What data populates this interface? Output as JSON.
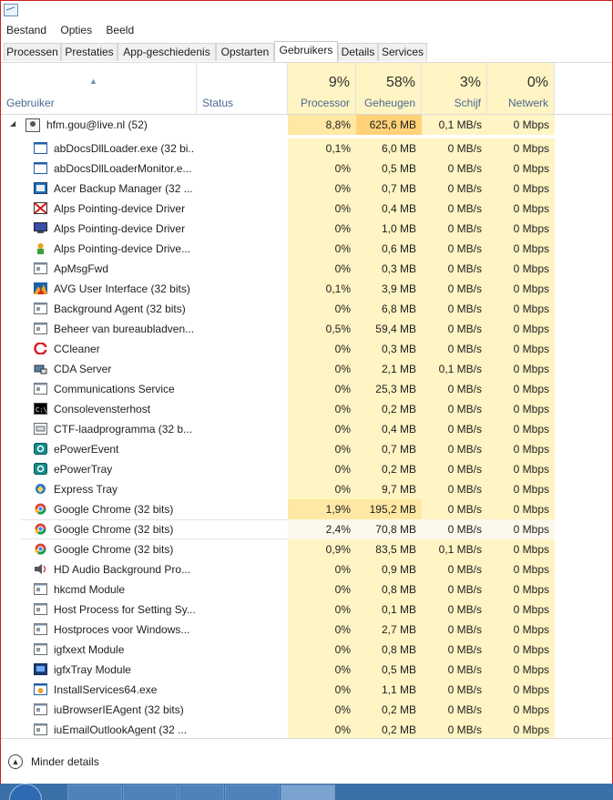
{
  "menu": [
    "Bestand",
    "Opties",
    "Beeld"
  ],
  "tabs": [
    {
      "label": "Processen",
      "active": false
    },
    {
      "label": "Prestaties",
      "active": false
    },
    {
      "label": "App-geschiedenis",
      "active": false
    },
    {
      "label": "Opstarten",
      "active": false
    },
    {
      "label": "Gebruikers",
      "active": true
    },
    {
      "label": "Details",
      "active": false
    },
    {
      "label": "Services",
      "active": false
    }
  ],
  "columns": {
    "user": "Gebruiker",
    "status": "Status",
    "cpu": {
      "pct": "9%",
      "label": "Processor"
    },
    "mem": {
      "pct": "58%",
      "label": "Geheugen"
    },
    "disk": {
      "pct": "3%",
      "label": "Schijf"
    },
    "net": {
      "pct": "0%",
      "label": "Netwerk"
    }
  },
  "group": {
    "name": "hfm.gou@live.nl (52)",
    "cpu": "8,8%",
    "mem": "625,6 MB",
    "disk": "0,1 MB/s",
    "net": "0 Mbps"
  },
  "processes": [
    {
      "name": "abDocsDllLoader.exe (32 bi...",
      "icon": "window-icon",
      "cpu": "0,1%",
      "mem": "6,0 MB",
      "disk": "0 MB/s",
      "net": "0 Mbps"
    },
    {
      "name": "abDocsDllLoaderMonitor.e...",
      "icon": "window-icon",
      "cpu": "0%",
      "mem": "0,5 MB",
      "disk": "0 MB/s",
      "net": "0 Mbps"
    },
    {
      "name": "Acer Backup Manager (32 ...",
      "icon": "backup-icon",
      "cpu": "0%",
      "mem": "0,7 MB",
      "disk": "0 MB/s",
      "net": "0 Mbps"
    },
    {
      "name": "Alps Pointing-device Driver",
      "icon": "alps-driver-icon",
      "cpu": "0%",
      "mem": "0,4 MB",
      "disk": "0 MB/s",
      "net": "0 Mbps"
    },
    {
      "name": "Alps Pointing-device Driver",
      "icon": "alps-monitor-icon",
      "cpu": "0%",
      "mem": "1,0 MB",
      "disk": "0 MB/s",
      "net": "0 Mbps"
    },
    {
      "name": "Alps Pointing-device Drive...",
      "icon": "alps-pointer-icon",
      "cpu": "0%",
      "mem": "0,6 MB",
      "disk": "0 MB/s",
      "net": "0 Mbps"
    },
    {
      "name": "ApMsgFwd",
      "icon": "service-icon",
      "cpu": "0%",
      "mem": "0,3 MB",
      "disk": "0 MB/s",
      "net": "0 Mbps"
    },
    {
      "name": "AVG User Interface (32 bits)",
      "icon": "avg-icon",
      "cpu": "0,1%",
      "mem": "3,9 MB",
      "disk": "0 MB/s",
      "net": "0 Mbps"
    },
    {
      "name": "Background Agent (32 bits)",
      "icon": "service-icon",
      "cpu": "0%",
      "mem": "6,8 MB",
      "disk": "0 MB/s",
      "net": "0 Mbps"
    },
    {
      "name": "Beheer van bureaubladven...",
      "icon": "service-icon",
      "cpu": "0,5%",
      "mem": "59,4 MB",
      "disk": "0 MB/s",
      "net": "0 Mbps"
    },
    {
      "name": "CCleaner",
      "icon": "ccleaner-icon",
      "cpu": "0%",
      "mem": "0,3 MB",
      "disk": "0 MB/s",
      "net": "0 Mbps"
    },
    {
      "name": "CDA Server",
      "icon": "cda-icon",
      "cpu": "0%",
      "mem": "2,1 MB",
      "disk": "0,1 MB/s",
      "net": "0 Mbps"
    },
    {
      "name": "Communications Service",
      "icon": "service-icon",
      "cpu": "0%",
      "mem": "25,3 MB",
      "disk": "0 MB/s",
      "net": "0 Mbps"
    },
    {
      "name": "Consolevensterhost",
      "icon": "console-icon",
      "cpu": "0%",
      "mem": "0,2 MB",
      "disk": "0 MB/s",
      "net": "0 Mbps"
    },
    {
      "name": "CTF-laadprogramma (32 b...",
      "icon": "ctf-icon",
      "cpu": "0%",
      "mem": "0,4 MB",
      "disk": "0 MB/s",
      "net": "0 Mbps"
    },
    {
      "name": "ePowerEvent",
      "icon": "epower-icon",
      "cpu": "0%",
      "mem": "0,7 MB",
      "disk": "0 MB/s",
      "net": "0 Mbps"
    },
    {
      "name": "ePowerTray",
      "icon": "epower-icon",
      "cpu": "0%",
      "mem": "0,2 MB",
      "disk": "0 MB/s",
      "net": "0 Mbps"
    },
    {
      "name": "Express Tray",
      "icon": "express-icon",
      "cpu": "0%",
      "mem": "9,7 MB",
      "disk": "0 MB/s",
      "net": "0 Mbps"
    },
    {
      "name": "Google Chrome (32 bits)",
      "icon": "chrome-icon",
      "cpu": "1,9%",
      "mem": "195,2 MB",
      "disk": "0 MB/s",
      "net": "0 Mbps"
    },
    {
      "name": "Google Chrome (32 bits)",
      "icon": "chrome-icon",
      "cpu": "2,4%",
      "mem": "70,8 MB",
      "disk": "0 MB/s",
      "net": "0 Mbps",
      "selected": true
    },
    {
      "name": "Google Chrome (32 bits)",
      "icon": "chrome-icon",
      "cpu": "0,9%",
      "mem": "83,5 MB",
      "disk": "0,1 MB/s",
      "net": "0 Mbps"
    },
    {
      "name": "HD Audio Background Pro...",
      "icon": "speaker-icon",
      "cpu": "0%",
      "mem": "0,9 MB",
      "disk": "0 MB/s",
      "net": "0 Mbps"
    },
    {
      "name": "hkcmd Module",
      "icon": "service-icon",
      "cpu": "0%",
      "mem": "0,8 MB",
      "disk": "0 MB/s",
      "net": "0 Mbps"
    },
    {
      "name": "Host Process for Setting Sy...",
      "icon": "service-icon",
      "cpu": "0%",
      "mem": "0,1 MB",
      "disk": "0 MB/s",
      "net": "0 Mbps"
    },
    {
      "name": "Hostproces voor Windows...",
      "icon": "service-icon",
      "cpu": "0%",
      "mem": "2,7 MB",
      "disk": "0 MB/s",
      "net": "0 Mbps"
    },
    {
      "name": "igfxext Module",
      "icon": "service-icon",
      "cpu": "0%",
      "mem": "0,8 MB",
      "disk": "0 MB/s",
      "net": "0 Mbps"
    },
    {
      "name": "igfxTray Module",
      "icon": "igfx-icon",
      "cpu": "0%",
      "mem": "0,5 MB",
      "disk": "0 MB/s",
      "net": "0 Mbps"
    },
    {
      "name": "InstallServices64.exe",
      "icon": "installer-icon",
      "cpu": "0%",
      "mem": "1,1 MB",
      "disk": "0 MB/s",
      "net": "0 Mbps"
    },
    {
      "name": "iuBrowserIEAgent (32 bits)",
      "icon": "service-icon",
      "cpu": "0%",
      "mem": "0,2 MB",
      "disk": "0 MB/s",
      "net": "0 Mbps"
    },
    {
      "name": "iuEmailOutlookAgent (32 ...",
      "icon": "service-icon",
      "cpu": "0%",
      "mem": "0,2 MB",
      "disk": "0 MB/s",
      "net": "0 Mbps"
    }
  ],
  "footer": {
    "label": "Minder details"
  },
  "colors": {
    "heat_low": "#fff4c4",
    "heat_mid": "#ffe8a3",
    "heat_high": "#ffd27a",
    "selected": "#fbf8ec",
    "accent": "#4b6b8f"
  }
}
